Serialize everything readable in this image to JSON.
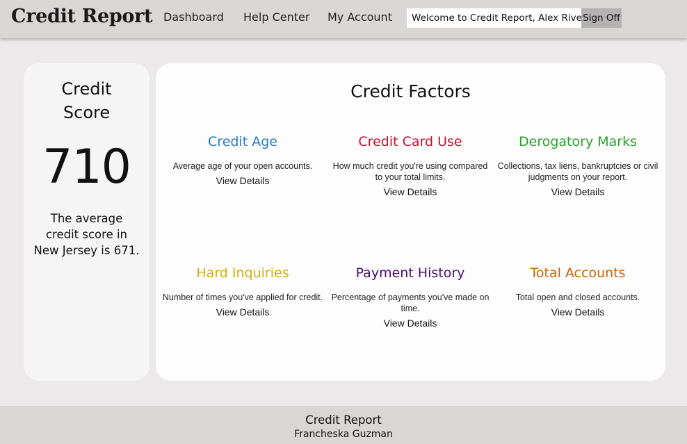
{
  "header": {
    "brand": "Credit Report",
    "nav": [
      {
        "label": "Dashboard"
      },
      {
        "label": "Help Center"
      },
      {
        "label": "My Account"
      }
    ],
    "welcome": "Welcome to Credit Report, Alex Rivera.",
    "signoff": "Sign Off"
  },
  "score": {
    "title_line1": "Credit",
    "title_line2": "Score",
    "value": "710",
    "note": "The average credit score in New Jersey is 671."
  },
  "factors": {
    "title": "Credit Factors",
    "items": [
      {
        "name": "Credit Age",
        "color": "#2b7bbf",
        "description": "Average age of your open accounts.",
        "link": "View Details"
      },
      {
        "name": "Credit Card Use",
        "color": "#c8102e",
        "description": "How much credit you're using compared to your total limits.",
        "link": "View Details"
      },
      {
        "name": "Derogatory Marks",
        "color": "#2ba12b",
        "description": "Collections, tax liens, bankruptcies or civil judgments on your report.",
        "link": "View Details"
      },
      {
        "name": "Hard Inquiries",
        "color": "#d4b000",
        "description": "Number of times you've applied for credit.",
        "link": "View Details"
      },
      {
        "name": "Payment History",
        "color": "#4b0a6e",
        "description": "Percentage of payments you've made on time.",
        "link": "View Details"
      },
      {
        "name": "Total Accounts",
        "color": "#d06000",
        "description": "Total open and closed accounts.",
        "link": "View Details"
      }
    ]
  },
  "footer": {
    "title": "Credit Report",
    "author": "Francheska Guzman"
  }
}
